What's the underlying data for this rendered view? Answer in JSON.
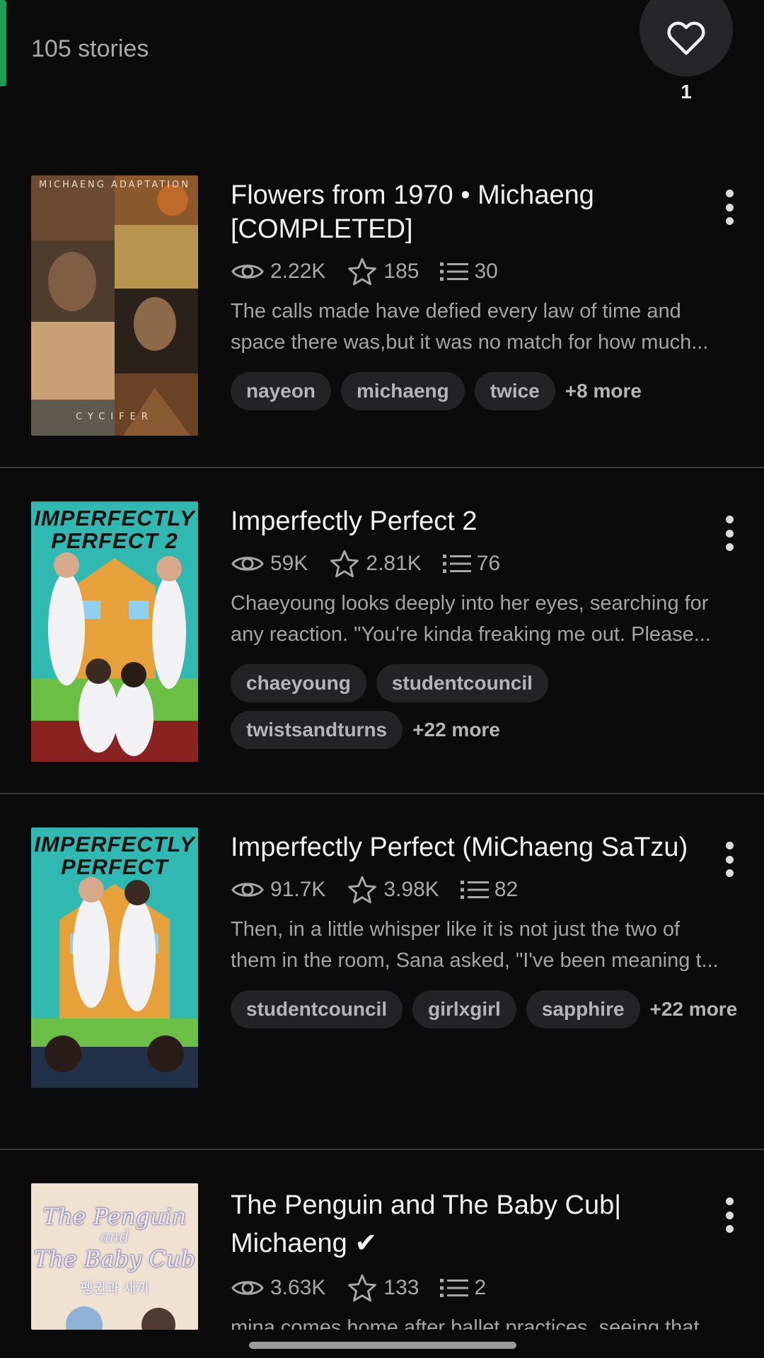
{
  "header": {
    "story_count": "105 stories",
    "like_count": "1"
  },
  "stories": [
    {
      "title": "Flowers from 1970 • Michaeng [COMPLETED]",
      "views": "2.22K",
      "votes": "185",
      "parts": "30",
      "description_lines": [
        "The calls made have defied every law of time and",
        "space there was,but it was no match for how much..."
      ],
      "tags": [
        "nayeon",
        "michaeng",
        "twice"
      ],
      "more": "+8 more",
      "cover": {
        "style": "collage",
        "top_text": "MICHAENG ADAPTATION",
        "bottom_text": "CYCIFER"
      }
    },
    {
      "title": "Imperfectly Perfect 2",
      "views": "59K",
      "votes": "2.81K",
      "parts": "76",
      "description_lines": [
        "Chaeyoung looks deeply into her eyes, searching for",
        "any reaction. \"You're kinda freaking me out. Please..."
      ],
      "tags": [
        "chaeyoung",
        "studentcouncil",
        "twistsandturns"
      ],
      "more": "+22 more",
      "cover": {
        "style": "school",
        "line1": "IMPERFECTLY",
        "line2": "PERFECT 2"
      }
    },
    {
      "title": "Imperfectly Perfect (MiChaeng SaTzu)",
      "views": "91.7K",
      "votes": "3.98K",
      "parts": "82",
      "description_lines": [
        "Then, in a little whisper like it is not just the two of",
        "them in the room, Sana asked, \"I've been meaning t..."
      ],
      "tags": [
        "studentcouncil",
        "girlxgirl",
        "sapphire"
      ],
      "more": "+22 more",
      "cover": {
        "style": "school",
        "line1": "IMPERFECTLY",
        "line2": "PERFECT"
      }
    },
    {
      "title": "The Penguin and The Baby Cub| Michaeng ✔",
      "views": "3.63K",
      "votes": "133",
      "parts": "2",
      "description_lines": [
        "mina comes home after ballet practices, seeing that"
      ],
      "tags": [],
      "more": "",
      "cover": {
        "style": "script",
        "line1": "The Penguin",
        "line2": "and",
        "line3": "The Baby Cub",
        "sub": "펭귄과 새끼"
      }
    }
  ],
  "colors": {
    "background": "#0b0b0c",
    "accent": "#1f9d55",
    "tag_bg": "#232325",
    "school_cover": "#2fb9b0"
  },
  "icons": {
    "like": "heart-icon",
    "views": "eye-icon",
    "votes": "star-icon",
    "parts": "list-icon",
    "menu": "more-vert-icon"
  }
}
